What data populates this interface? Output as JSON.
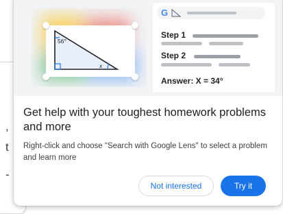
{
  "background_page": {
    "fragments": [
      ",",
      "t",
      "-"
    ]
  },
  "illustration": {
    "triangle": {
      "angle_label": "56°",
      "x_label": "x"
    },
    "steps_card": {
      "search_icon_letter": "G",
      "step1_label": "Step 1",
      "step2_label": "Step 2",
      "answer_label": "Answer: X = 34°"
    }
  },
  "promo": {
    "title": "Get help with your toughest homework problems and more",
    "description": "Right-click and choose \"Search with Google Lens\" to select a problem and learn more",
    "secondary_button": "Not interested",
    "primary_button": "Try it"
  },
  "colors": {
    "accent": "#1a73e8",
    "hero_bg": "#f1f3f4"
  }
}
